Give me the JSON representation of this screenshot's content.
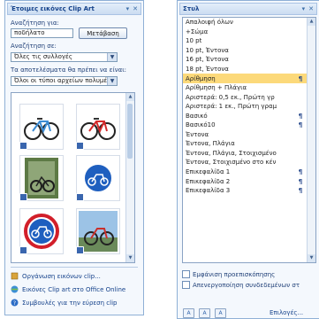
{
  "clip_art": {
    "title": "Έτοιμες εικόνες Clip Art",
    "search_label": "Αναζήτηση για:",
    "search_value": "ποδήλατο",
    "search_button": "Μετάβαση",
    "search_in_label": "Αναζήτηση σε:",
    "search_in_value": "Όλες τις συλλογές",
    "results_label": "Τα αποτελέσματα θα πρέπει να είναι:",
    "results_value": "Όλοι οι τύποι αρχείων πολυμέσ",
    "links": [
      "Οργάνωση εικόνων clip...",
      "Εικόνες Clip art στο Office Online",
      "Συμβουλές για την εύρεση clip"
    ]
  },
  "styles": {
    "title": "Στυλ",
    "items": [
      {
        "name": "Απαλοιφή όλων",
        "mark": ""
      },
      {
        "name": "+Σώμα",
        "mark": ""
      },
      {
        "name": "10 pt",
        "mark": ""
      },
      {
        "name": "10 pt, Έντονα",
        "mark": ""
      },
      {
        "name": "16 pt, Έντονα",
        "mark": ""
      },
      {
        "name": "18 pt, Έντονα",
        "mark": ""
      },
      {
        "name": "Αρίθμηση",
        "mark": "¶"
      },
      {
        "name": "Αρίθμηση + Πλάγια",
        "mark": ""
      },
      {
        "name": "Αριστερά: 0,5 εκ., Πρώτη γρ",
        "mark": ""
      },
      {
        "name": "Αριστερά: 1 εκ., Πρώτη γραμ",
        "mark": ""
      },
      {
        "name": "Βασικό",
        "mark": "¶"
      },
      {
        "name": "Βασικό10",
        "mark": "¶"
      },
      {
        "name": "Έντονα",
        "mark": ""
      },
      {
        "name": "Έντονα, Πλάγια",
        "mark": ""
      },
      {
        "name": "Έντονα, Πλάγια, Στοιχισμένο",
        "mark": ""
      },
      {
        "name": "Έντονα, Στοιχισμένο στο κέν",
        "mark": ""
      },
      {
        "name": "Επικεφαλίδα 1",
        "mark": "¶"
      },
      {
        "name": "Επικεφαλίδα 2",
        "mark": "¶"
      },
      {
        "name": "Επικεφαλίδα 3",
        "mark": "¶"
      }
    ],
    "show_preview": "Εμφάνιση προεπισκόπησης",
    "disable_linked": "Απενεργοποίηση συνδεδεμένων στ",
    "options_link": "Επιλογές..."
  },
  "colors": {
    "accent": "#15428b",
    "selected": "#fcd97a",
    "border": "#8fb0d6"
  }
}
